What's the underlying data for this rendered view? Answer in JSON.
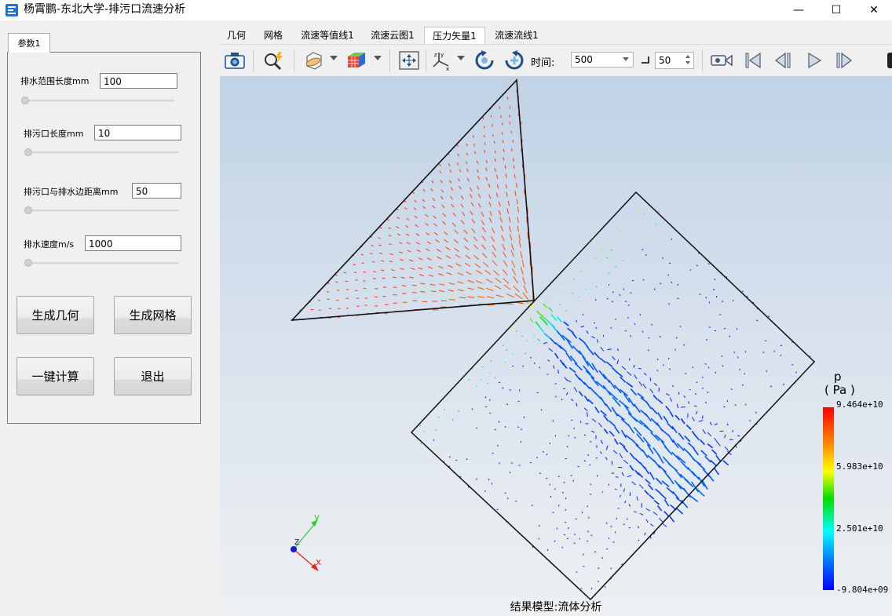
{
  "window": {
    "title": "杨霄鹏-东北大学-排污口流速分析",
    "minimize_glyph": "—",
    "maximize_glyph": "☐",
    "close_glyph": "✕"
  },
  "left": {
    "tab_label": "参数1",
    "params": [
      {
        "label": "排水范围长度mm",
        "value": "100"
      },
      {
        "label": "排污口长度mm",
        "value": "10"
      },
      {
        "label": "排污口与排水边距离mm",
        "value": "50"
      },
      {
        "label": "排水速度m/s",
        "value": "1000"
      }
    ],
    "buttons": {
      "gen_geometry": "生成几何",
      "gen_mesh": "生成网格",
      "compute": "一键计算",
      "exit": "退出"
    }
  },
  "tabs": [
    "几何",
    "网格",
    "流速等值线1",
    "流速云图1",
    "压力矢量1",
    "流速流线1"
  ],
  "active_tab": "压力矢量1",
  "toolbar": {
    "time_label": "时间:",
    "time_value": "500",
    "step_value": "50"
  },
  "viewport": {
    "legend": {
      "title": "p",
      "unit": "( Pa )",
      "ticks": [
        "9.464e+10",
        "5.983e+10",
        "2.501e+10",
        "-9.804e+09"
      ]
    },
    "axes": {
      "y": "y",
      "z": "z",
      "x": "x"
    },
    "caption": "结果模型:流体分析"
  },
  "colors": {
    "accent_blue": "#1e73d2",
    "legend_high": "#ff0000",
    "legend_low": "#0000ff"
  }
}
